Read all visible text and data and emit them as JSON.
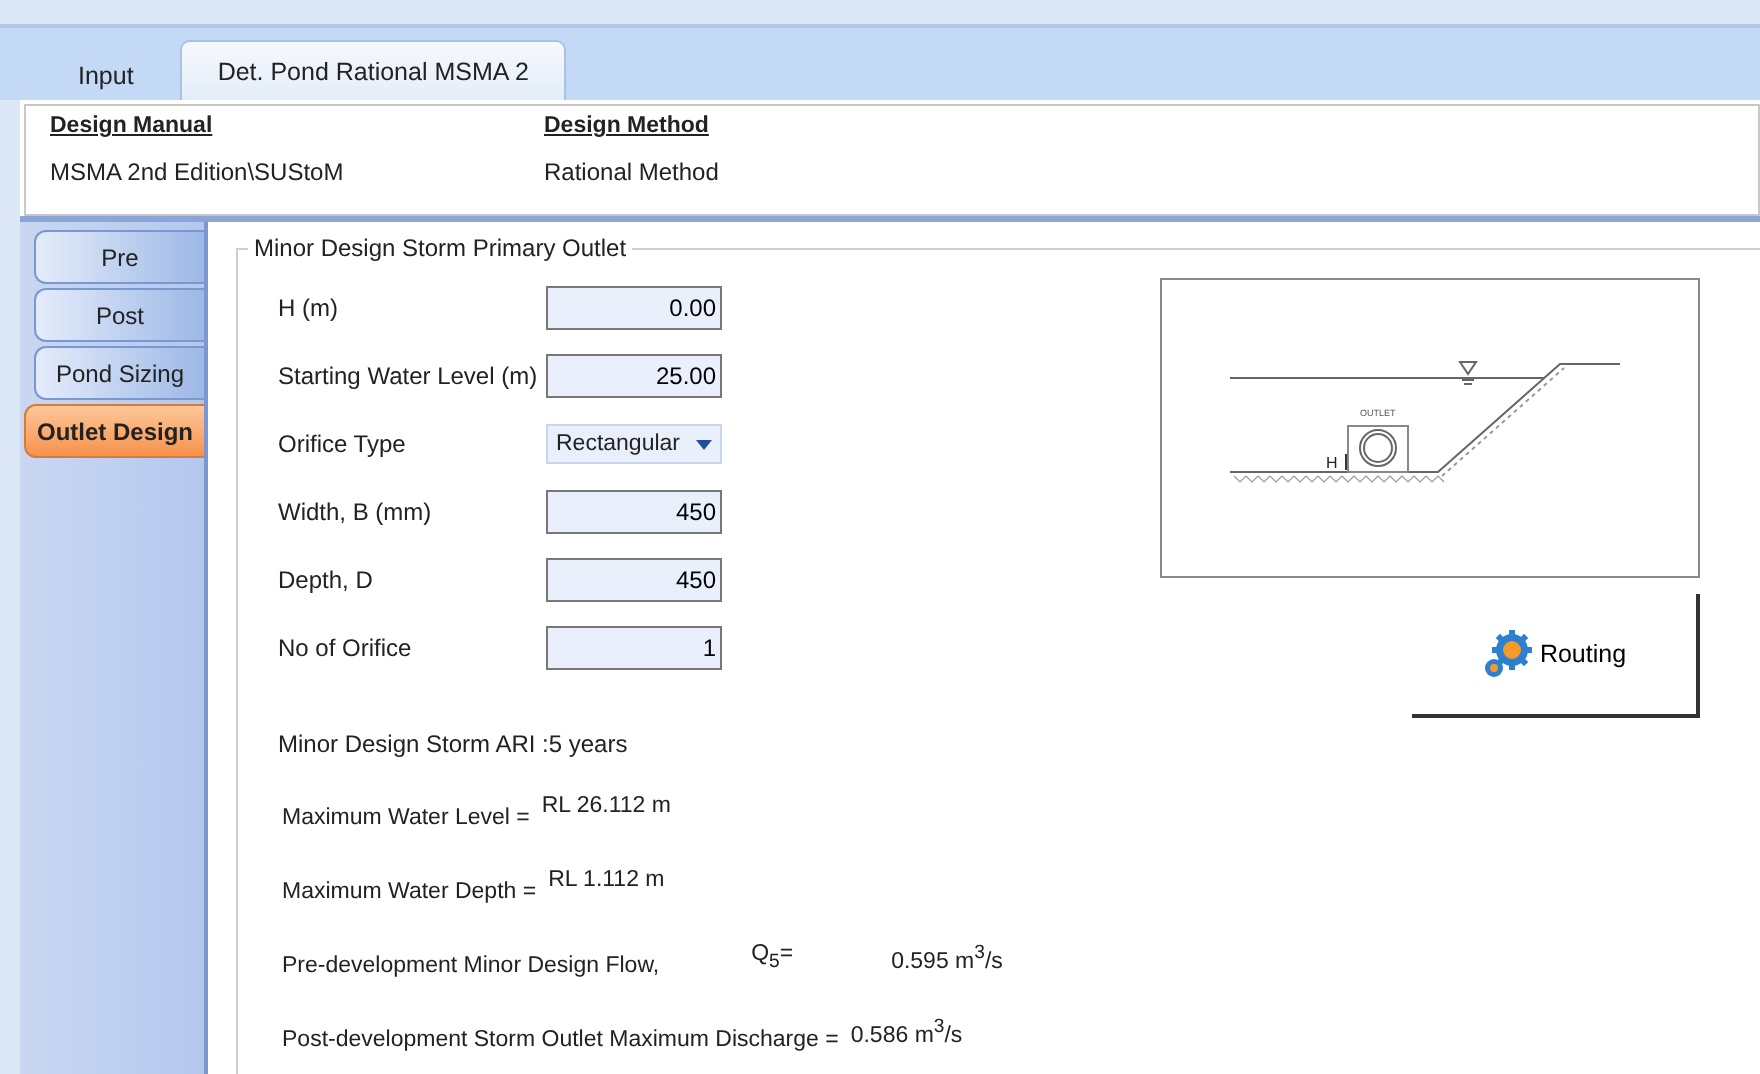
{
  "tabs": [
    {
      "label": "Input",
      "selected": false
    },
    {
      "label": "Det. Pond Rational MSMA 2",
      "selected": true
    }
  ],
  "header": {
    "columns": [
      {
        "heading": "Design Manual",
        "value": "MSMA 2nd Edition\\SUStoM"
      },
      {
        "heading": "Design Method",
        "value": "Rational Method"
      }
    ]
  },
  "side_tabs": [
    {
      "label": "Pre",
      "selected": false
    },
    {
      "label": "Post",
      "selected": false
    },
    {
      "label": "Pond Sizing",
      "selected": false
    },
    {
      "label": "Outlet Design",
      "selected": true
    }
  ],
  "group": {
    "title": "Minor Design Storm Primary Outlet",
    "fields": [
      {
        "kind": "text",
        "label": "H (m)",
        "value": "0.00"
      },
      {
        "kind": "text",
        "label": "Starting Water Level (m)",
        "value": "25.00"
      },
      {
        "kind": "select",
        "label": "Orifice Type",
        "value": "Rectangular"
      },
      {
        "kind": "text",
        "label": "Width, B (mm)",
        "value": "450"
      },
      {
        "kind": "text",
        "label": "Depth, D",
        "value": "450"
      },
      {
        "kind": "text",
        "label": "No of Orifice",
        "value": "1"
      }
    ],
    "diagram": {
      "caption": "OUTLET",
      "marker": "H"
    },
    "routing_button": "Routing",
    "ari": "Minor Design Storm ARI :5 years",
    "results": [
      {
        "label": "Maximum Water Level =",
        "value": "RL 26.112 m"
      },
      {
        "label": "Maximum Water Depth =",
        "value": "RL 1.112 m"
      },
      {
        "label": "Pre-development Minor Design Flow,",
        "symbol": "Q$_{5}$=",
        "value": "0.595 m$^{3}$/s"
      },
      {
        "label": "Post-development Storm Outlet Maximum Discharge =",
        "value": "0.586 m$^{3}$/s"
      }
    ]
  }
}
